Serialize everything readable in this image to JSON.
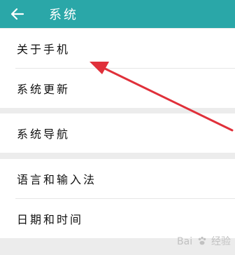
{
  "header": {
    "title": "系统",
    "back_icon": "arrow-left-icon",
    "background": "#2aa7a8"
  },
  "groups": [
    {
      "items": [
        "关于手机",
        "系统更新"
      ]
    },
    {
      "items": [
        "系统导航"
      ]
    },
    {
      "items": [
        "语言和输入法",
        "日期和时间"
      ]
    }
  ],
  "annotation": {
    "color": "#e0303a",
    "icon": "red-arrow"
  },
  "watermark": {
    "left": "Bai",
    "right": "经验"
  }
}
